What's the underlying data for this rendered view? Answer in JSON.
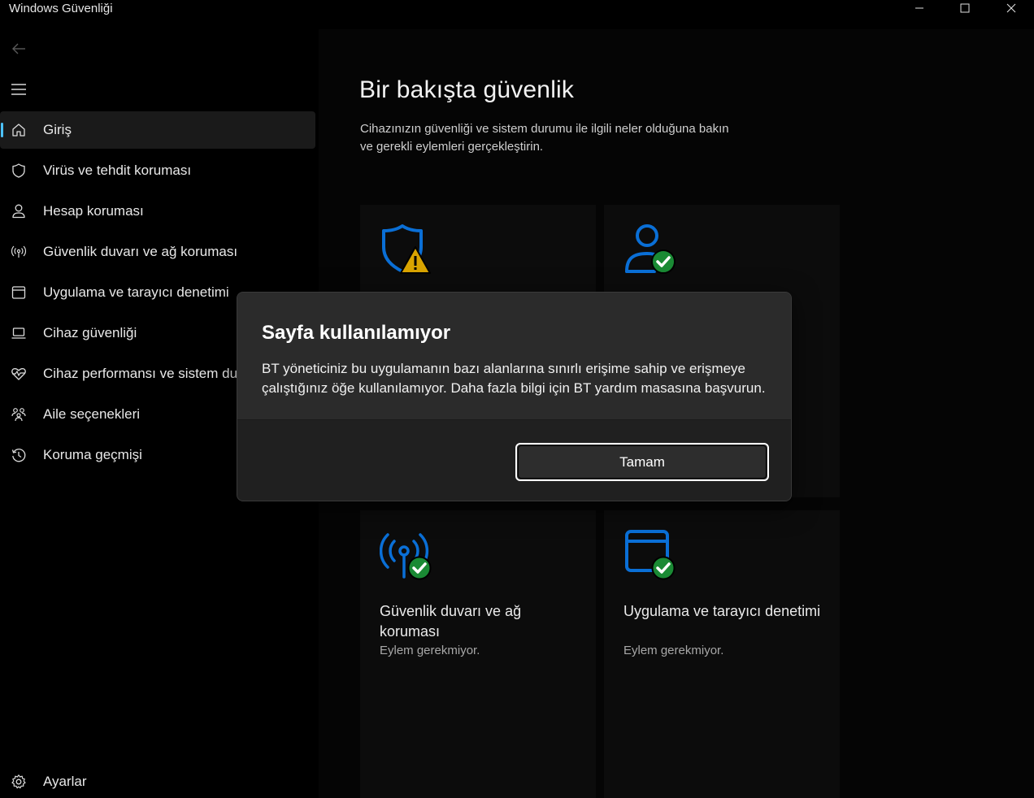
{
  "window": {
    "title": "Windows Güvenliği"
  },
  "sidebar": {
    "items": [
      {
        "label": "Giriş",
        "icon": "home-icon",
        "active": true
      },
      {
        "label": "Virüs ve tehdit koruması",
        "icon": "shield-icon"
      },
      {
        "label": "Hesap koruması",
        "icon": "person-icon"
      },
      {
        "label": "Güvenlik duvarı ve ağ koruması",
        "icon": "antenna-icon"
      },
      {
        "label": "Uygulama ve tarayıcı denetimi",
        "icon": "app-window-icon"
      },
      {
        "label": "Cihaz güvenliği",
        "icon": "laptop-icon"
      },
      {
        "label": "Cihaz performansı ve sistem durumu",
        "icon": "heart-pulse-icon"
      },
      {
        "label": "Aile seçenekleri",
        "icon": "family-icon"
      },
      {
        "label": "Koruma geçmişi",
        "icon": "history-icon"
      }
    ],
    "settings_label": "Ayarlar"
  },
  "main": {
    "title": "Bir bakışta güvenlik",
    "description": "Cihazınızın güvenliği ve sistem durumu ile ilgili neler olduğuna bakın ve gerekli eylemleri gerçekleştirin.",
    "cards": [
      {
        "icon": "shield-warning-icon"
      },
      {
        "icon": "account-check-icon"
      },
      {
        "title": "Güvenlik duvarı ve ağ koruması",
        "status": "Eylem gerekmiyor.",
        "icon": "firewall-check-icon"
      },
      {
        "title": "Uygulama ve tarayıcı denetimi",
        "status": "Eylem gerekmiyor.",
        "icon": "app-browser-check-icon"
      }
    ]
  },
  "dialog": {
    "title": "Sayfa kullanılamıyor",
    "message": "BT yöneticiniz bu uygulamanın bazı alanlarına sınırlı erişime sahip ve erişmeye çalıştığınız öğe kullanılamıyor. Daha fazla bilgi için BT yardım masasına başvurun.",
    "ok_label": "Tamam"
  },
  "colors": {
    "accent": "#4cc2ff",
    "icon_blue": "#0a6fd6",
    "check_green": "#1a8a34",
    "warning_yellow": "#d9a400"
  }
}
